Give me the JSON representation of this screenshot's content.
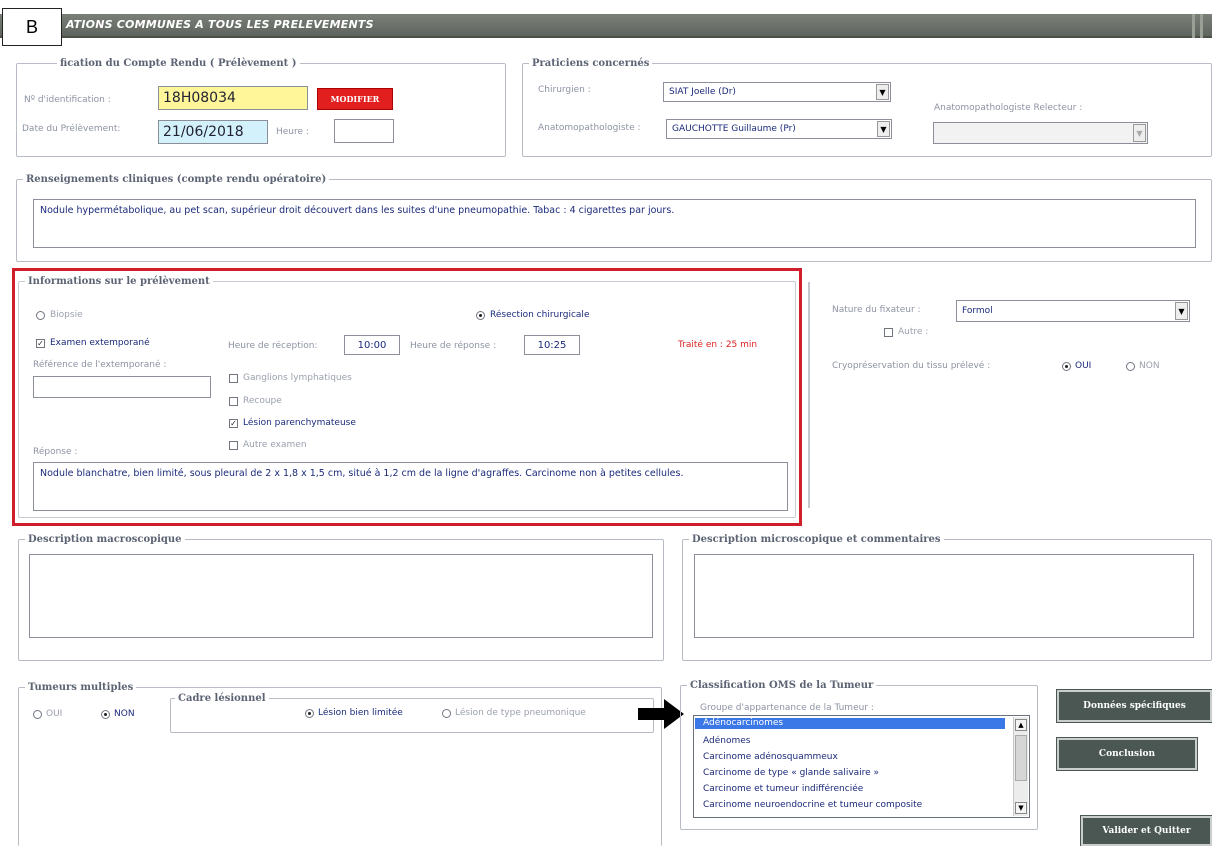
{
  "header": {
    "title": "ATIONS COMMUNES A TOUS LES PRELEVEMENTS"
  },
  "panel_label": "B",
  "identification": {
    "legend": "fication du Compte Rendu ( Prélèvement )",
    "id_label": "Nº d'identification :",
    "id_value": "18H08034",
    "modify_button": "MODIFIER",
    "date_label": "Date du Prélèvement:",
    "date_value": "21/06/2018",
    "hour_label": "Heure :",
    "hour_value": ""
  },
  "praticiens": {
    "legend": "Praticiens concernés",
    "chirurgien_label": "Chirurgien :",
    "chirurgien_value": "SIAT Joelle (Dr)",
    "anapath_label": "Anatomopathologiste :",
    "anapath_value": "GAUCHOTTE Guillaume (Pr)",
    "relecteur_label": "Anatomopathologiste Relecteur :",
    "relecteur_value": ""
  },
  "renseignements": {
    "legend": "Renseignements cliniques (compte rendu opératoire)",
    "text": "Nodule hypermétabolique, au pet scan, supérieur droit découvert dans les suites d'une pneumopathie. Tabac : 4 cigarettes par jours."
  },
  "prelevement": {
    "legend": "Informations sur le prélèvement",
    "biopsie": "Biopsie",
    "resection": "Résection chirurgicale",
    "extempo": "Examen extemporané",
    "heure_reception_label": "Heure de réception:",
    "heure_reception": "10:00",
    "heure_reponse_label": "Heure de réponse :",
    "heure_reponse": "10:25",
    "traite": "Traité en : 25 min",
    "reference_label": "Référence de l'extemporané :",
    "reference_value": "",
    "ganglions": "Ganglions lymphatiques",
    "recoupe": "Recoupe",
    "lesion": "Lésion parenchymateuse",
    "autre_examen": "Autre examen",
    "reponse_label": "Réponse :",
    "reponse_text": "Nodule blanchatre, bien limité, sous pleural de 2 x 1,8 x 1,5 cm, situé à 1,2 cm de la ligne d'agraffes. Carcinome non à petites cellules."
  },
  "fixateur": {
    "nature_label": "Nature du fixateur :",
    "nature_value": "Formol",
    "autre": "Autre :",
    "cryo_label": "Cryopréservation du tissu prélevé :",
    "oui": "OUI",
    "non": "NON"
  },
  "macro": {
    "legend": "Description macroscopique",
    "text": ""
  },
  "micro": {
    "legend": "Description microscopique et commentaires",
    "text": ""
  },
  "tumeurs": {
    "legend": "Tumeurs multiples",
    "oui": "OUI",
    "non": "NON",
    "cadre_legend": "Cadre lésionnel",
    "bien_limitee": "Lésion bien limitée",
    "pneumonique": "Lésion de type pneumonique"
  },
  "oms": {
    "legend": "Classification OMS de la Tumeur",
    "groupe_label": "Groupe d'appartenance de la Tumeur :",
    "items": [
      "Adénocarcinomes",
      "Adénomes",
      "Carcinome adénosquammeux",
      "Carcinome de type « glande salivaire »",
      "Carcinome et tumeur indifférenciée",
      "Carcinome neuroendocrine et tumeur composite"
    ]
  },
  "buttons": {
    "donnees": "Données spécifiques",
    "conclusion": "Conclusion",
    "valider": "Valider et Quitter"
  },
  "colors": {
    "header": "#6a7068",
    "highlight_frame": "#d01e2a",
    "dark_button": "#4a5753",
    "selection": "#3b78e7"
  }
}
